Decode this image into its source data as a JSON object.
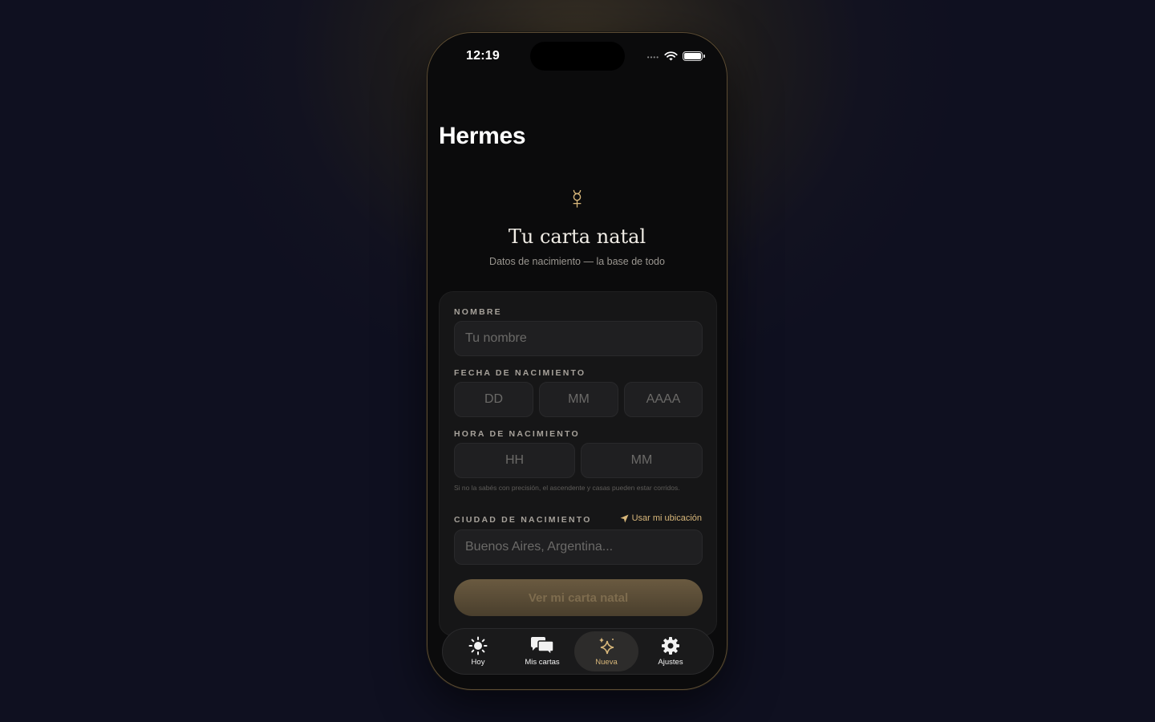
{
  "status": {
    "time": "12:19"
  },
  "app": {
    "title": "Hermes"
  },
  "hero": {
    "glyph": "☿",
    "title": "Tu carta natal",
    "subtitle": "Datos de nacimiento — la base de todo"
  },
  "form": {
    "name": {
      "label": "NOMBRE",
      "placeholder": "Tu nombre"
    },
    "birth_date": {
      "label": "FECHA DE NACIMIENTO",
      "day_placeholder": "DD",
      "month_placeholder": "MM",
      "year_placeholder": "AAAA"
    },
    "birth_time": {
      "label": "HORA DE NACIMIENTO",
      "hour_placeholder": "HH",
      "minute_placeholder": "MM",
      "hint": "Si no la sabés con precisión, el ascendente y casas pueden estar corridos."
    },
    "birth_city": {
      "label": "CIUDAD DE NACIMIENTO",
      "placeholder": "Buenos Aires, Argentina...",
      "use_location": "Usar mi ubicación"
    },
    "submit": "Ver mi carta natal"
  },
  "tabs": [
    {
      "label": "Hoy",
      "icon": "sun-icon"
    },
    {
      "label": "Mis cartas",
      "icon": "chat-bubbles-icon"
    },
    {
      "label": "Nueva",
      "icon": "sparkles-icon",
      "active": true
    },
    {
      "label": "Ajustes",
      "icon": "gear-icon"
    }
  ],
  "colors": {
    "accent": "#d8b77a",
    "background": "#0b0b0c",
    "card": "#161617"
  }
}
